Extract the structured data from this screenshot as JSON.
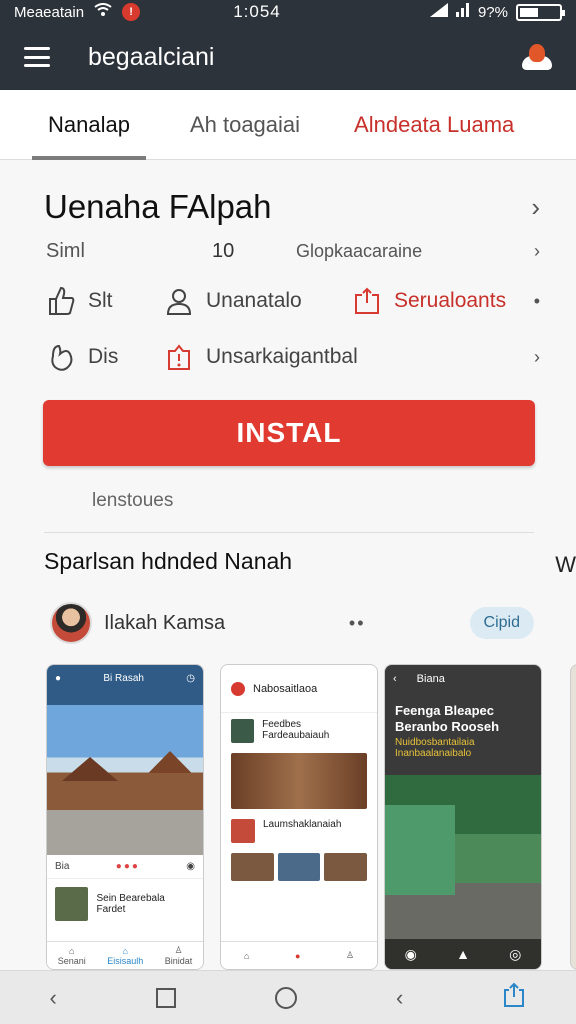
{
  "status_bar": {
    "carrier": "Meaeatain",
    "time": "1:054",
    "battery": "9?%"
  },
  "app_bar": {
    "title": "begaalciani"
  },
  "tabs": [
    {
      "label": "Nanalap"
    },
    {
      "label": "Ah toagaiai"
    },
    {
      "label": "Alndeata Luama"
    }
  ],
  "app": {
    "title": "Uenaha FAlpah",
    "meta": {
      "left": "Siml",
      "count": "10",
      "right": "Glopkaacaraine"
    },
    "actions_row1": {
      "item1": "Slt",
      "item2": "Unanatalo",
      "item3": "Serualoants"
    },
    "actions_row2": {
      "item1": "Dis",
      "item2": "Unsarkaigantbal"
    },
    "install_label": "INSTAL",
    "sub_note": "lenstoues"
  },
  "section": {
    "title": "Sparlsan hdnded Nanah",
    "author": "Ilakah Kamsa",
    "pill": "Cipid"
  },
  "screenshots": {
    "s1": {
      "header": "Bi Rasah",
      "bar_label": "Bia",
      "item": "Sein Bearebala Fardet",
      "nav": [
        "Senani",
        "Eisisaulh",
        "Binidat"
      ]
    },
    "s2": {
      "header": "Nabosaitlaoa",
      "post1": "Feedbes Fardeaubaiauh",
      "post2": "Laumshaklanaiah"
    },
    "s3": {
      "header": "Biana",
      "title": "Feenga Bleapec Beranbo Rooseh",
      "sub": "Nuidbosbantailaia Inanbaalanaibalo"
    }
  },
  "colors": {
    "accent": "#e03a31",
    "appbar": "#2d333a",
    "pill_bg": "#dcebf3"
  }
}
